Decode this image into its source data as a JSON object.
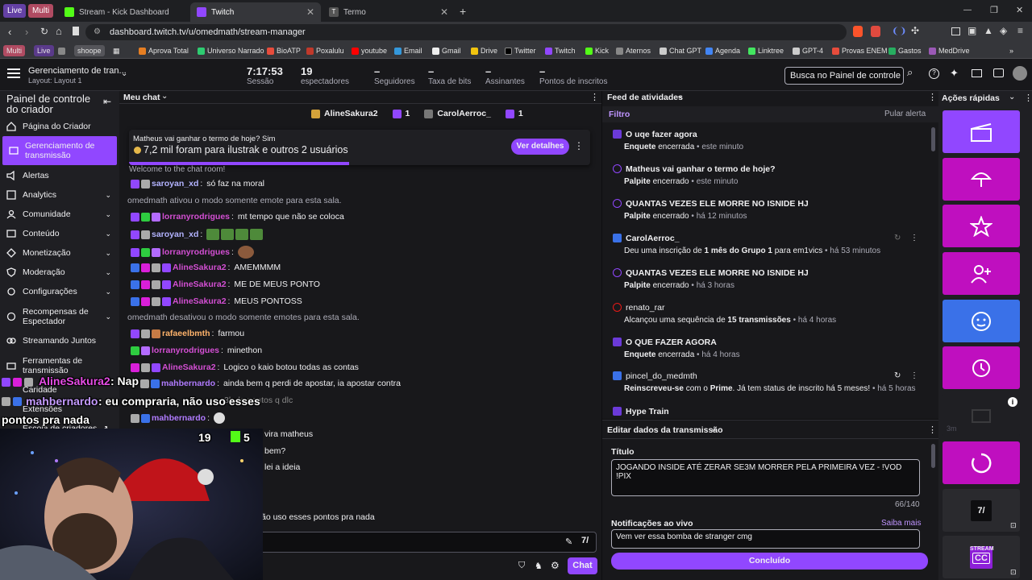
{
  "tabbar": {
    "pill_live": "Live",
    "pill_multi": "Multi",
    "tabs": [
      {
        "title": "Stream - Kick Dashboard"
      },
      {
        "title": "Twitch"
      },
      {
        "title": "Termo"
      }
    ],
    "new_tab": "+",
    "win_min": "—",
    "win_max": "❐",
    "win_close": "✕"
  },
  "toolbar": {
    "url": "dashboard.twitch.tv/u/omedmath/stream-manager"
  },
  "bookmarks": [
    "Multi",
    "Live",
    "shoope",
    "Aprova Total",
    "Universo Narrado",
    "BioATP",
    "Poxalulu",
    "youtube",
    "Email",
    "Gmail",
    "Drive",
    "Twitter",
    "Twitch",
    "Kick",
    "Aternos",
    "Chat GPT",
    "Agenda",
    "Linktree",
    "GPT-4",
    "Provas ENEM",
    "Gastos",
    "MedDrive"
  ],
  "header": {
    "title": "Gerenciamento de tran...",
    "layout": "Layout: Layout 1",
    "stats": [
      {
        "value": "7:17:53",
        "label": "Sessão"
      },
      {
        "value": "19",
        "label": "espectadores"
      },
      {
        "value": "–",
        "label": "Seguidores"
      },
      {
        "value": "–",
        "label": "Taxa de bits"
      },
      {
        "value": "–",
        "label": "Assinantes"
      },
      {
        "value": "–",
        "label": "Pontos de inscritos"
      }
    ],
    "search_placeholder": "Busca no Painel de controle (C"
  },
  "sidebar": {
    "title": "Painel de controle do criador",
    "items": [
      {
        "label": "Página do Criador"
      },
      {
        "label": "Gerenciamento de transmissão"
      },
      {
        "label": "Alertas"
      },
      {
        "label": "Analytics"
      },
      {
        "label": "Comunidade"
      },
      {
        "label": "Conteúdo"
      },
      {
        "label": "Monetização"
      },
      {
        "label": "Moderação"
      },
      {
        "label": "Configurações"
      },
      {
        "label": "Recompensas de Espectador"
      },
      {
        "label": "Streamando Juntos"
      },
      {
        "label": "Ferramentas de transmissão"
      },
      {
        "label": "Caridade"
      },
      {
        "label": "Extensões"
      },
      {
        "label": "Escola de criadores"
      }
    ]
  },
  "chat": {
    "title": "Meu chat",
    "top_users": [
      {
        "name": "AlineSakura2",
        "count": "1"
      },
      {
        "name": "CarolAerroc_",
        "count": "1"
      }
    ],
    "prediction": {
      "question": "Matheus vai ganhar o termo de hoje? Sim",
      "amount": "7,2 mil foram para ilustrak e outros 2 usuários",
      "button": "Ver detalhes"
    },
    "welcome": "Welcome to the chat room!",
    "messages": [
      {
        "user": "saroyan_xd",
        "color": "#b3b3ff",
        "text": "só faz na moral"
      },
      {
        "system": "omedmath ativou o modo somente emote para esta sala."
      },
      {
        "user": "lorranyrodrigues",
        "color": "#d34fd3",
        "text": "mt tempo que não se coloca"
      },
      {
        "user": "saroyan_xd",
        "color": "#b3b3ff",
        "text": ""
      },
      {
        "user": "lorranyrodrigues",
        "color": "#d34fd3",
        "text": ""
      },
      {
        "user": "AlineSakura2",
        "color": "#d34fd3",
        "text": "AMEMMMM"
      },
      {
        "user": "AlineSakura2",
        "color": "#d34fd3",
        "text": "ME DE MEUS PONTO"
      },
      {
        "user": "AlineSakura2",
        "color": "#d34fd3",
        "text": "MEUS PONTOSS"
      },
      {
        "system": "omedmath desativou o modo somente emotes para esta sala."
      },
      {
        "user": "rafaeelbmth",
        "color": "#ffb36b",
        "text": "farmou"
      },
      {
        "user": "lorranyrodrigues",
        "color": "#d34fd3",
        "text": "minethon"
      },
      {
        "user": "AlineSakura2",
        "color": "#d34fd3",
        "text": "Logico o kaio botou todas as contas"
      },
      {
        "user": "mahbernardo",
        "color": "#b07bff",
        "text": "ainda bem q perdi de apostar, ia apostar contra"
      },
      {
        "user": "",
        "color": "#b07bff",
        "text": "3k de pontos q dlc"
      },
      {
        "user": "mahbernardo",
        "color": "#b07bff",
        "text": ""
      }
    ],
    "partial_lines": [
      "vira matheus",
      "bem?",
      "lei a ideia",
      "ão uso esses pontos pra nada"
    ],
    "send_button": "Chat"
  },
  "activity": {
    "title": "Feed de atividades",
    "filter": "Filtro",
    "skip": "Pular alerta",
    "items": [
      {
        "title": "O uqe fazer agora",
        "sub": "Enquete",
        "sub2": "encerrada",
        "time": "este minuto"
      },
      {
        "title": "Matheus vai ganhar o termo de hoje?",
        "sub": "Palpite",
        "sub2": "encerrado",
        "time": "este minuto"
      },
      {
        "title": "QUANTAS VEZES ELE MORRE NO ISNIDE HJ",
        "sub": "Palpite",
        "sub2": "encerrado",
        "time": "há 12 minutos"
      },
      {
        "title": "CarolAerroc_",
        "sub": "Deu uma inscrição de",
        "b1": "1 mês do Grupo 1",
        "mid": "para em1vics",
        "time": "há 53 minutos"
      },
      {
        "title": "QUANTAS VEZES ELE MORRE NO ISNIDE HJ",
        "sub": "Palpite",
        "sub2": "encerrado",
        "time": "há 3 horas"
      },
      {
        "title": "renato_rar",
        "sub": "Alcançou uma sequência de",
        "b1": "15 transmissões",
        "time": "há 4 horas"
      },
      {
        "title": "O QUE FAZER AGORA",
        "sub": "Enquete",
        "sub2": "encerrada",
        "time": "há 4 horas"
      },
      {
        "title": "pincel_do_medmth",
        "sub": "Reinscreveu-se",
        "mid": "com o",
        "b1": "Prime",
        "mid2": ". Já tem status de inscrito há 5 meses!",
        "time": "há 5 horas"
      },
      {
        "title": "Hype Train"
      }
    ]
  },
  "edit": {
    "title": "Editar dados da transmissão",
    "field_title_label": "Título",
    "field_title_value": "JOGANDO INSIDE ATÉ ZERAR SE3M MORRER PELA PRIMEIRA VEZ - !VOD !PIX",
    "counter": "66/140",
    "notif_label": "Notificações ao vivo",
    "learn_more": "Saiba mais",
    "notif_value": "Vem ver essa bomba de stranger cmg",
    "done_button": "Concluído"
  },
  "quick": {
    "title": "Ações rápidas",
    "timer_label": "3m",
    "stream_label": "STREAM",
    "cc_label": "CC"
  },
  "overlay": {
    "line1_user": "AlineSakura2",
    "line1_text": ": Nap",
    "line2_user": "mahbernardo",
    "line2_text": ": eu compraria, não uso esses",
    "line3_text": "pontos pra nada",
    "twitch_viewers": "19",
    "kick_viewers": "5"
  },
  "colors": {
    "accent": "#9147ff",
    "magenta": "#bf0fbf",
    "blue": "#3a71e8"
  }
}
